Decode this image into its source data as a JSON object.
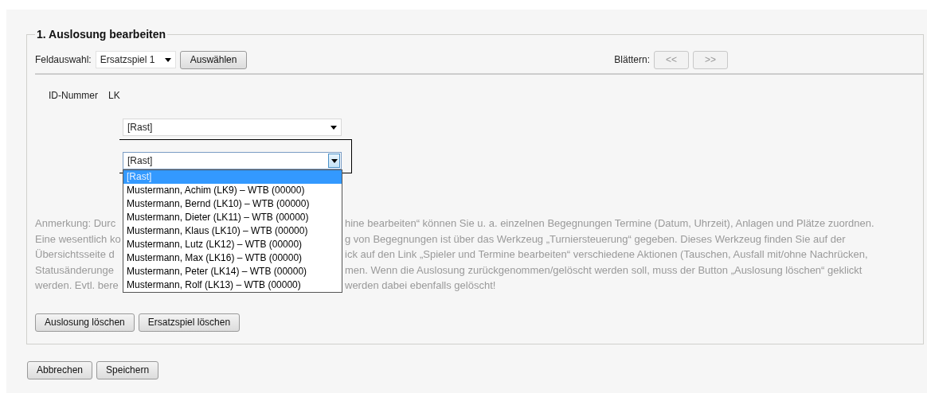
{
  "section": {
    "title": "1. Auslosung bearbeiten"
  },
  "toolbar": {
    "field_label": "Feldauswahl:",
    "field_select": {
      "value": "Ersatzspiel 1"
    },
    "select_button": "Auswählen",
    "paging_label": "Blättern:",
    "paging_buttons": [
      {
        "label": "<<",
        "disabled": true
      },
      {
        "label": ">>",
        "disabled": true
      }
    ]
  },
  "entry": {
    "id_label": "ID-Nummer",
    "lk_label": "LK",
    "select_1": {
      "value": "[Rast]"
    },
    "select_2": {
      "value": "[Rast]",
      "expanded": true,
      "options": [
        {
          "label": "[Rast]",
          "selected": true
        },
        {
          "label": "Mustermann, Achim (LK9) – WTB (00000)",
          "selected": false
        },
        {
          "label": "Mustermann, Bernd (LK10) – WTB (00000)",
          "selected": false
        },
        {
          "label": "Mustermann, Dieter (LK11) – WTB (00000)",
          "selected": false
        },
        {
          "label": "Mustermann, Klaus (LK10) – WTB (00000)",
          "selected": false
        },
        {
          "label": "Mustermann, Lutz (LK12) – WTB (00000)",
          "selected": false
        },
        {
          "label": "Mustermann, Max (LK16) – WTB (00000)",
          "selected": false
        },
        {
          "label": "Mustermann, Peter (LK14) – WTB (00000)",
          "selected": false
        },
        {
          "label": "Mustermann, Rolf (LK13) – WTB (00000)",
          "selected": false
        }
      ]
    }
  },
  "note_lines": [
    {
      "left": "Anmerkung: Durc",
      "right": "hine bearbeiten“ können Sie u. a. einzelnen Begegnungen Termine (Datum, Uhrzeit), Anlagen und Plätze zuordnen."
    },
    {
      "left": "Eine wesentlich ko",
      "right": "g von Begegnungen ist über das Werkzeug „Turniersteuerung“ gegeben. Dieses Werkzeug finden Sie auf der"
    },
    {
      "left": "Übersichtsseite d",
      "right": "ick auf den Link „Spieler und Termine bearbeiten“ verschiedene Aktionen (Tauschen, Ausfall mit/ohne Nachrücken,"
    },
    {
      "left": "Statusänderunge",
      "right": "men. Wenn die Auslosung zurückgenommen/gelöscht werden soll, muss der Button „Auslosung löschen“ geklickt"
    },
    {
      "left": "werden. Evtl. bere",
      "right": "werden dabei ebenfalls gelöscht!"
    }
  ],
  "section_buttons": [
    "Auslosung löschen",
    "Ersatzspiel löschen"
  ],
  "footer_buttons": [
    "Abbrechen",
    "Speichern"
  ]
}
